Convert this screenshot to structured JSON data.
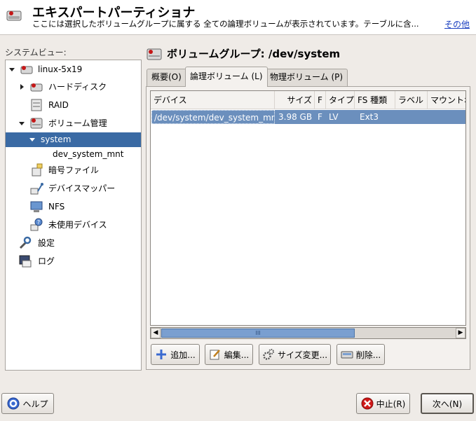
{
  "header": {
    "title": "エキスパートパーティショナ",
    "description": "ここには選択したボリュームグループに属する 全ての論理ボリュームが表示されています。テーブルに含...",
    "more_link": "その他"
  },
  "sidebar": {
    "label": "システムビュー:",
    "items": [
      {
        "label": "linux-5x19",
        "icon": "computer-icon"
      },
      {
        "label": "ハードディスク",
        "icon": "harddisk-icon"
      },
      {
        "label": "RAID",
        "icon": "raid-icon"
      },
      {
        "label": "ボリューム管理",
        "icon": "volume-manager-icon"
      },
      {
        "label": "system",
        "icon": "volume-group"
      },
      {
        "label": "dev_system_mnt",
        "icon": "logical-volume"
      },
      {
        "label": "暗号ファイル",
        "icon": "crypt-file-icon"
      },
      {
        "label": "デバイスマッパー",
        "icon": "device-mapper-icon"
      },
      {
        "label": "NFS",
        "icon": "nfs-icon"
      },
      {
        "label": "未使用デバイス",
        "icon": "unused-devices-icon"
      },
      {
        "label": "設定",
        "icon": "settings-icon"
      },
      {
        "label": "ログ",
        "icon": "log-icon"
      }
    ]
  },
  "main": {
    "title": "ボリュームグループ: /dev/system",
    "tabs": [
      {
        "label": "概要(O)",
        "active": false
      },
      {
        "label": "論理ボリューム (L)",
        "active": true
      },
      {
        "label": "物理ボリューム (P)",
        "active": false
      }
    ],
    "table": {
      "columns": [
        "デバイス",
        "サイズ",
        "F",
        "タイプ",
        "FS 種類",
        "ラベル",
        "マウントポ"
      ],
      "rows": [
        [
          "/dev/system/dev_system_mnt",
          "3.98 GB",
          "F",
          "LV",
          "Ext3",
          "",
          ""
        ]
      ]
    },
    "scrollbar_thumb": "III",
    "actions": {
      "add": "追加...",
      "edit": "編集...",
      "resize": "サイズ変更...",
      "delete": "削除..."
    }
  },
  "footer": {
    "help": "ヘルプ",
    "abort": "中止(R)",
    "next": "次へ(N)"
  },
  "colors": {
    "selection": "#3a6aa4",
    "row_selection": "#6b8fbd",
    "link": "#1a3fc0"
  }
}
